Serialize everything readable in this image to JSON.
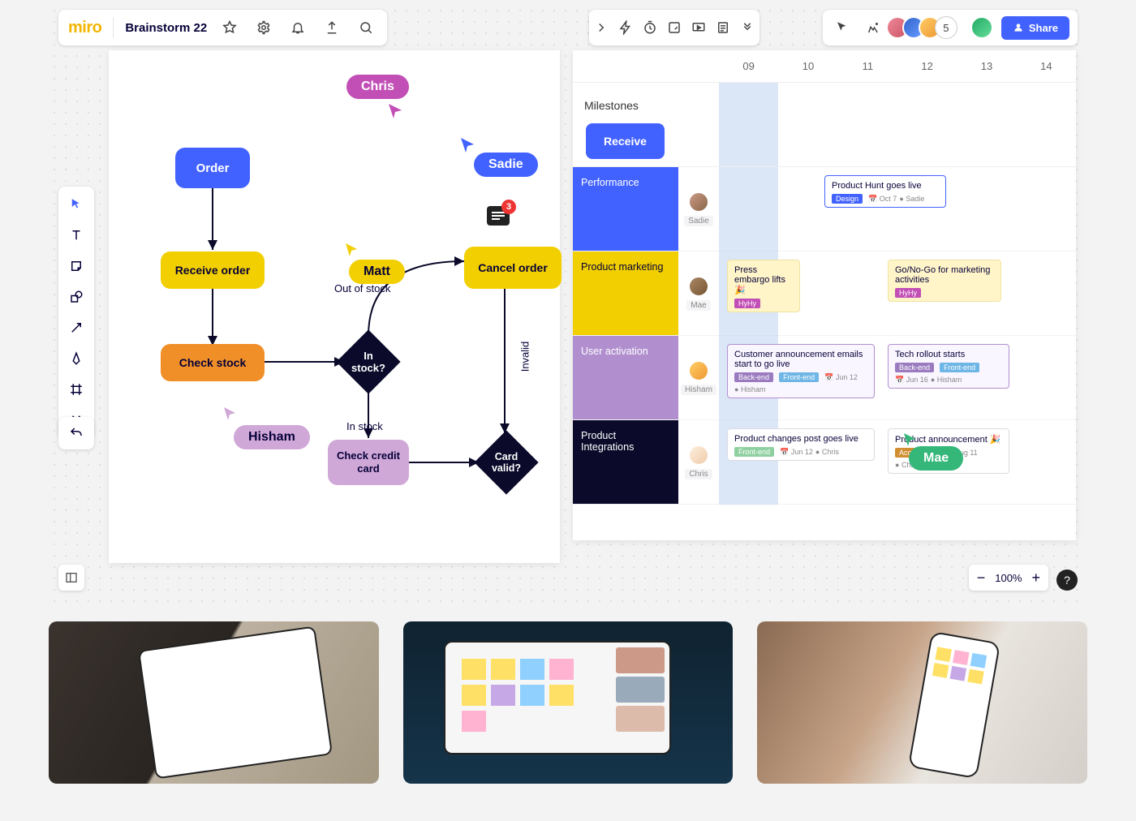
{
  "header": {
    "logo": "miro",
    "board_name": "Brainstorm 22",
    "avatar_count": "5",
    "share_label": "Share"
  },
  "zoom": {
    "level": "100%"
  },
  "cursors": {
    "chris": "Chris",
    "sadie": "Sadie",
    "matt": "Matt",
    "hisham": "Hisham",
    "mae": "Mae"
  },
  "comment_badge": "3",
  "flowchart": {
    "order": "Order",
    "receive_order": "Receive order",
    "check_stock": "Check stock",
    "in_stock_q": "In stock?",
    "out_of_stock": "Out of stock",
    "cancel_order": "Cancel order",
    "in_stock": "In stock",
    "check_cc": "Check credit card",
    "card_valid_q": "Card valid?",
    "invalid": "Invalid"
  },
  "timeline": {
    "cols": [
      "09",
      "10",
      "11",
      "12",
      "13",
      "14"
    ],
    "milestones_label": "Milestones",
    "receive_chip": "Receive",
    "rows": [
      {
        "label": "Performance",
        "color": "#4262ff",
        "name": "Sadie"
      },
      {
        "label": "Product marketing",
        "color": "#f2cf00",
        "name": "Mae"
      },
      {
        "label": "User activation",
        "color": "#b18fcf",
        "name": "Hisham"
      },
      {
        "label": "Product Integrations",
        "color": "#0b0a2a",
        "name": "Chris"
      }
    ],
    "cards": {
      "ph_live": "Product Hunt goes live",
      "design_tag": "Design",
      "oct7": "Oct 7",
      "sadie": "Sadie",
      "embargo": "Press embargo lifts 🎉",
      "hyhy": "HyHy",
      "gono": "Go/No-Go for marketing activities",
      "ann": "Customer announcement emails start to go live",
      "backend": "Back-end",
      "frontend": "Front-end",
      "jun12": "Jun 12",
      "hisham": "Hisham",
      "tech": "Tech rollout starts",
      "jun16": "Jun 16",
      "pchanges": "Product changes post goes live",
      "frontend2": "Front-end",
      "chris": "Chris",
      "pann": "Product announcement 🎉",
      "acq": "Acquisition",
      "aug11": "Aug 11"
    }
  }
}
